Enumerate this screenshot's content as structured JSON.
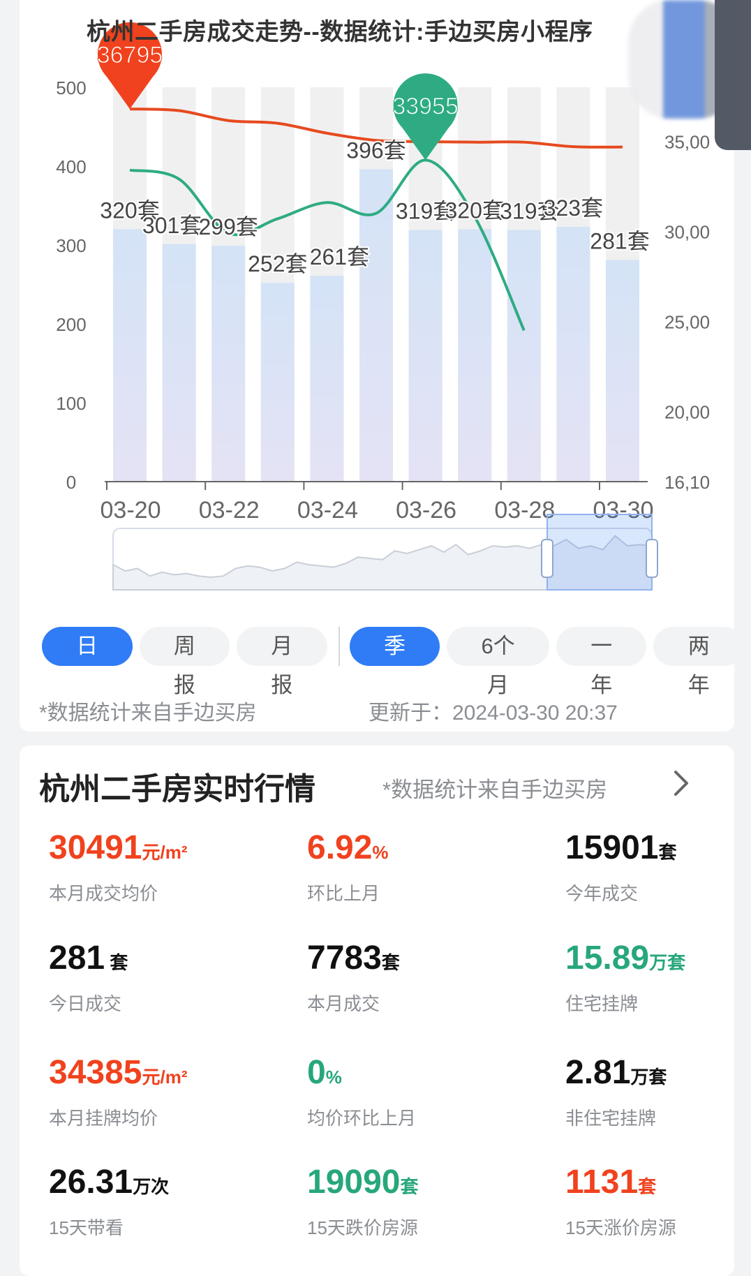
{
  "chart_data": {
    "type": "bar",
    "title": "杭州二手房成交走势--数据统计:手边买房小程序",
    "categories": [
      "03-20",
      "03-21",
      "03-22",
      "03-23",
      "03-24",
      "03-25",
      "03-26",
      "03-27",
      "03-28",
      "03-29",
      "03-30"
    ],
    "x_tick_labels": [
      "03-20",
      "03-22",
      "03-24",
      "03-26",
      "03-28",
      "03-30"
    ],
    "y_left_ticks": [
      "500",
      "400",
      "300",
      "200",
      "100",
      "0"
    ],
    "y_right_ticks": [
      "35,00",
      "30,00",
      "25,00",
      "20,00",
      "16,10"
    ],
    "ylim_left": [
      0,
      500
    ],
    "ylim_right": [
      16100,
      38000
    ],
    "series": [
      {
        "type": "bar",
        "values": [
          320,
          301,
          299,
          252,
          261,
          396,
          319,
          320,
          319,
          323,
          281
        ],
        "data_labels": [
          "320套",
          "301套",
          "299套",
          "252套",
          "261套",
          "396套",
          "319套",
          "320套",
          "319套",
          "323套",
          "281套"
        ]
      },
      {
        "type": "line",
        "color": "#e64a1e",
        "values": [
          36795,
          36700,
          36150,
          36000,
          35450,
          35050,
          34980,
          34950,
          34950,
          34700,
          34680
        ]
      },
      {
        "type": "line",
        "color": "#2eab82",
        "values": [
          33400,
          32900,
          29900,
          30700,
          31600,
          31000,
          33955,
          30800,
          24500
        ]
      }
    ],
    "markers": [
      {
        "label": "36795",
        "color": "#f0421e"
      },
      {
        "label": "33955",
        "color": "#2eab82"
      }
    ],
    "grid": false
  },
  "controls": {
    "tabs_left": [
      "日报",
      "周报",
      "月报"
    ],
    "tabs_right": [
      "季度",
      "6个月",
      "一年",
      "两年"
    ],
    "active_left": "日报",
    "active_right": "季度",
    "source_note": "*数据统计来自手边买房",
    "updated": "更新于：2024-03-30 20:37"
  },
  "market": {
    "title": "杭州二手房实时行情",
    "subtitle": "*数据统计来自手边买房",
    "stats": [
      {
        "value": "30491",
        "unit": "元/m²",
        "label": "本月成交均价",
        "color": "red"
      },
      {
        "value": "6.92",
        "unit": "%",
        "label": "环比上月",
        "color": "red"
      },
      {
        "value": "15901",
        "unit": "套",
        "label": "今年成交",
        "color": "black"
      },
      {
        "value": "281",
        "unit": " 套",
        "label": "今日成交",
        "color": "black"
      },
      {
        "value": "7783",
        "unit": "套",
        "label": "本月成交",
        "color": "black"
      },
      {
        "value": "15.89",
        "unit": "万套",
        "label": "住宅挂牌",
        "color": "green"
      },
      {
        "value": "34385",
        "unit": "元/m²",
        "label": "本月挂牌均价",
        "color": "red"
      },
      {
        "value": "0",
        "unit": "%",
        "label": "均价环比上月",
        "color": "green"
      },
      {
        "value": "2.81",
        "unit": "万套",
        "label": "非住宅挂牌",
        "color": "black"
      },
      {
        "value": "26.31",
        "unit": "万次",
        "label": "15天带看",
        "color": "black"
      },
      {
        "value": "19090",
        "unit": "套",
        "label": "15天跌价房源",
        "color": "green"
      },
      {
        "value": "1131",
        "unit": "套",
        "label": "15天涨价房源",
        "color": "red"
      }
    ]
  }
}
